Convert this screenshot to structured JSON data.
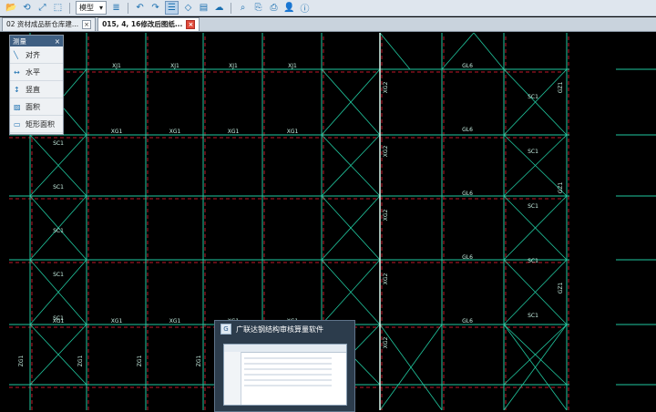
{
  "toolbar": {
    "mode_select": "模型",
    "icons": [
      "open-folder-icon",
      "history-icon",
      "zoom-extents-icon",
      "zoom-window-icon",
      "mode-select",
      "layers-icon",
      "undo-icon",
      "redo-icon",
      "grid-icon",
      "erase-icon",
      "property-icon",
      "cloud-icon",
      "find-icon",
      "copy-icon",
      "print-icon",
      "user-icon",
      "info-icon"
    ]
  },
  "tabs": [
    {
      "label": "02 资材成品新仓库建...",
      "active": false
    },
    {
      "label": "015, 4, 16修改后图纸...",
      "active": true
    }
  ],
  "palette": {
    "title": "测量",
    "items": [
      {
        "label": "对齐",
        "icon": "align-icon"
      },
      {
        "label": "水平",
        "icon": "horizontal-icon"
      },
      {
        "label": "竖直",
        "icon": "vertical-icon"
      },
      {
        "label": "面积",
        "icon": "area-icon"
      },
      {
        "label": "矩形面积",
        "icon": "rect-area-icon"
      }
    ]
  },
  "popup": {
    "title": "广联达钢结构审核算量软件"
  },
  "drawing": {
    "colors": {
      "background": "#000000",
      "grid": "#21c9a0",
      "axis_dash": "#c0182a",
      "highlight": "#d6f7ee",
      "text": "#c8f1e4"
    },
    "labels": {
      "row_top": [
        "XJ1",
        "XJ1",
        "XJ1",
        "XJ1",
        "XJ1"
      ],
      "row_mid": [
        "XG1",
        "XG1",
        "XG1",
        "XG1",
        "XG1"
      ],
      "row_bottom": [
        "XG1",
        "XG1",
        "XG1",
        "XG1",
        "XG1"
      ],
      "col_labels": [
        "SC1",
        "SC1",
        "SC1",
        "SC1",
        "SC1",
        "SC1"
      ],
      "right_beams": [
        "GL6",
        "GL6",
        "GL6",
        "GL6",
        "GL6"
      ],
      "right_cols": [
        "SC1",
        "SC1",
        "SC1",
        "SC1",
        "SC1"
      ],
      "vertical_left": [
        "XG2",
        "XG2",
        "XG2",
        "XG2",
        "XG2"
      ],
      "vertical_right": [
        "GZ1",
        "GZ1",
        "GZ1"
      ],
      "bottom_row": [
        "ZG1",
        "ZG1",
        "ZG1",
        "ZG1"
      ]
    }
  }
}
